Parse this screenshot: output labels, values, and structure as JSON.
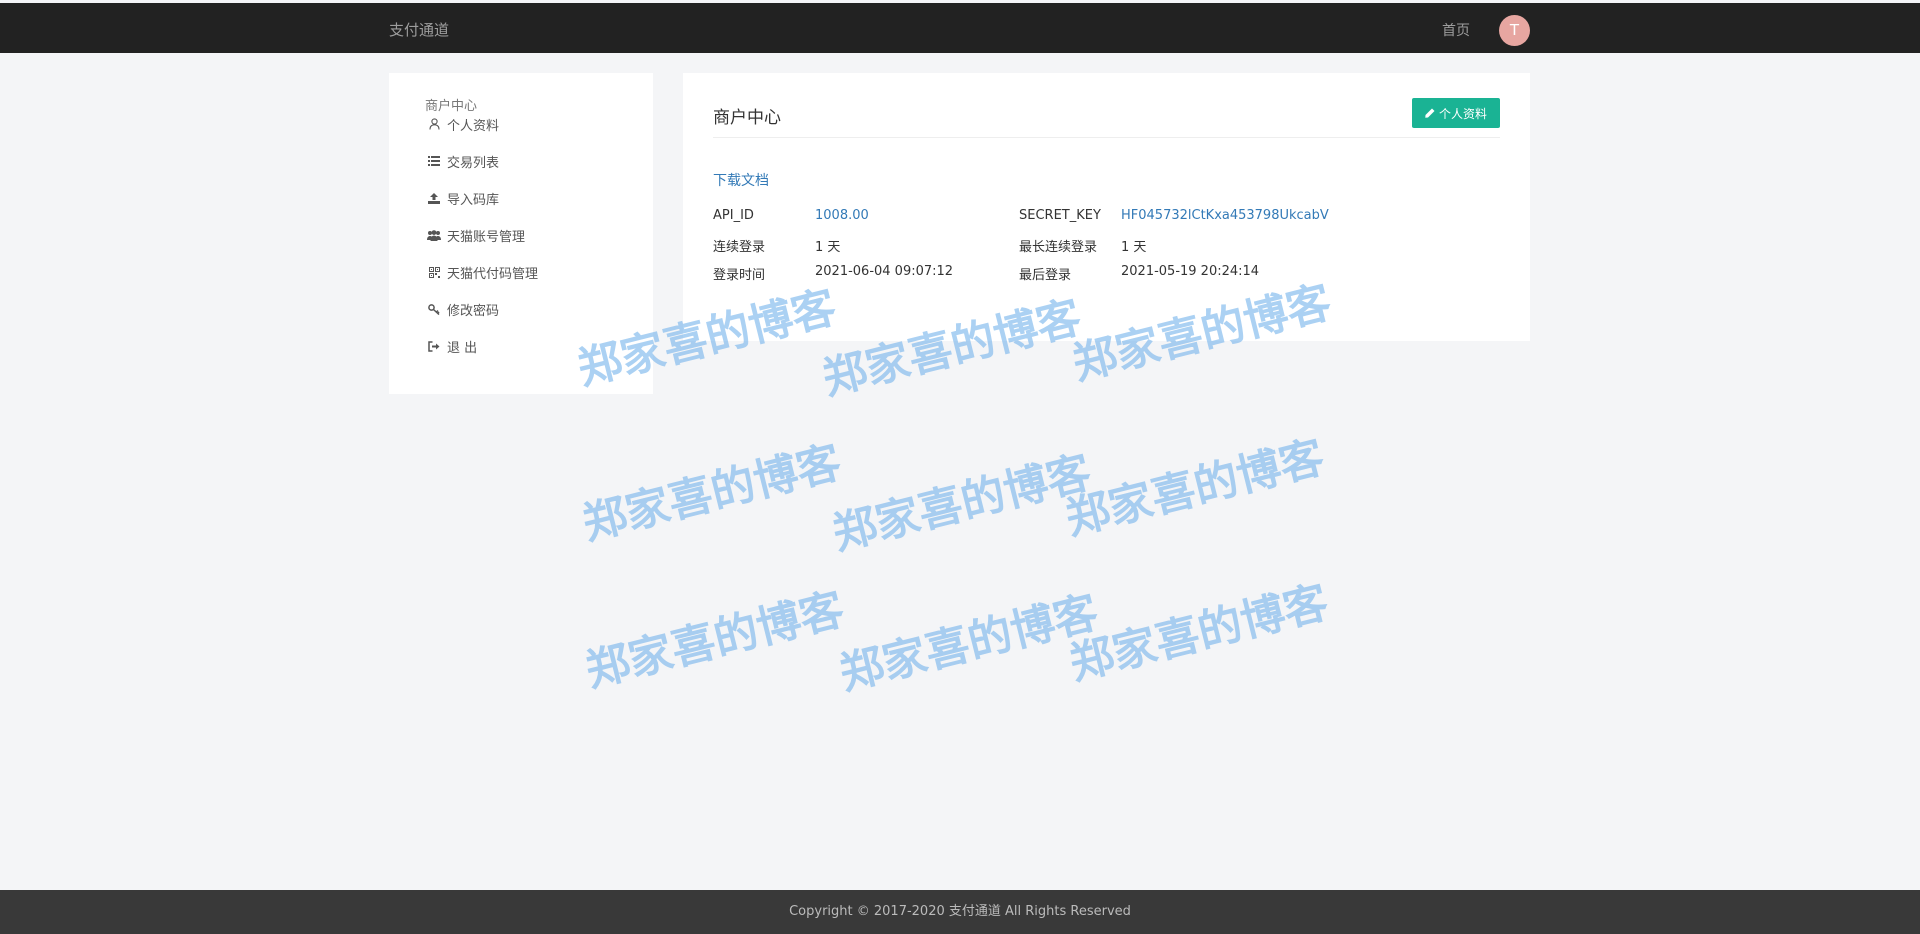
{
  "topbar": {
    "brand": "支付通道",
    "home_label": "首页",
    "avatar_letter": "T"
  },
  "sidebar": {
    "heading": "商户中心",
    "items": [
      {
        "label": "个人资料",
        "icon": "user-icon"
      },
      {
        "label": "交易列表",
        "icon": "list-icon"
      },
      {
        "label": "导入码库",
        "icon": "upload-icon"
      },
      {
        "label": "天猫账号管理",
        "icon": "users-icon"
      },
      {
        "label": "天猫代付码管理",
        "icon": "qrcode-icon"
      },
      {
        "label": "修改密码",
        "icon": "key-icon"
      },
      {
        "label": "退 出",
        "icon": "sign-out-icon"
      }
    ]
  },
  "main": {
    "title": "商户中心",
    "profile_button": "个人资料",
    "doc_link": "下载文档",
    "info": {
      "api_id_label": "API_ID",
      "api_id_value": "1008.00",
      "secret_key_label": "SECRET_KEY",
      "secret_key_value": "HF045732lCtKxa453798UkcabV",
      "consecutive_login_label": "连续登录",
      "consecutive_login_value": "1 天",
      "longest_login_label": "最长连续登录",
      "longest_login_value": "1 天",
      "login_time_label": "登录时间",
      "login_time_value": "2021-06-04 09:07:12",
      "last_login_label": "最后登录",
      "last_login_value": "2021-05-19 20:24:14"
    }
  },
  "watermark_text": "郑家喜的博客",
  "footer": {
    "copyright": "Copyright © 2017-2020 支付通道 All Rights Reserved"
  },
  "colors": {
    "topbar": "#222222",
    "accent": "#1ab394",
    "link": "#337ab7",
    "avatar": "#e7a6a1",
    "footer": "#393939",
    "watermark": "#78b4eb"
  }
}
